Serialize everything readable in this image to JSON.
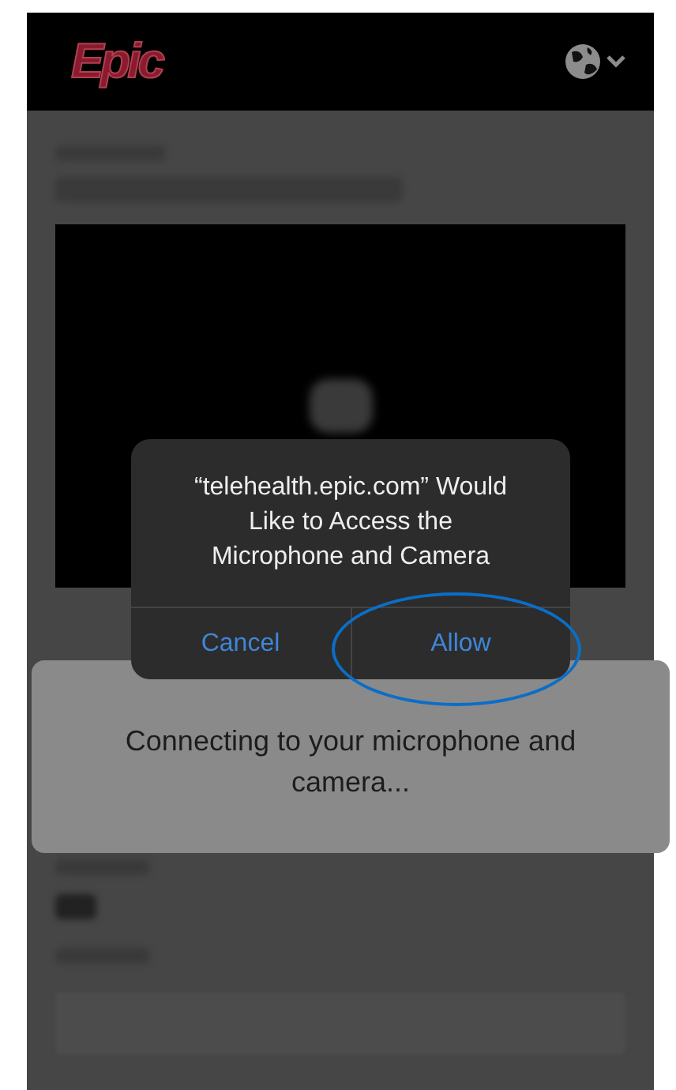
{
  "header": {
    "logo": "Epic"
  },
  "permission_dialog": {
    "message": "“telehealth.epic.com” Would Like to Access the Microphone and Camera",
    "buttons": [
      {
        "label": "Cancel",
        "highlighted": false
      },
      {
        "label": "Allow",
        "highlighted": true
      }
    ]
  },
  "toast": {
    "message": "Connecting to your microphone and camera..."
  }
}
